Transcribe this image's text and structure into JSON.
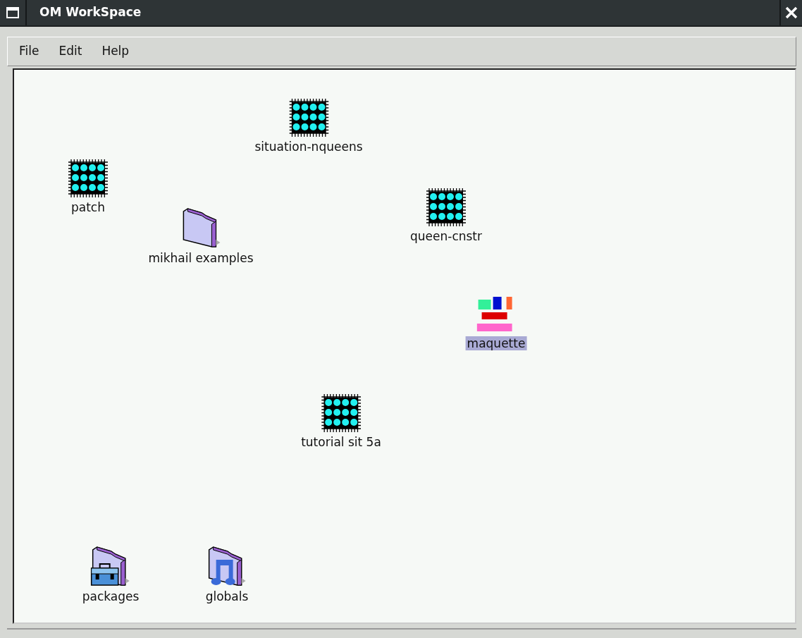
{
  "window": {
    "title": "OM WorkSpace"
  },
  "menu": [
    "File",
    "Edit",
    "Help"
  ],
  "items": [
    {
      "label": "situation-nqueens",
      "kind": "patch",
      "selected": false
    },
    {
      "label": "patch",
      "kind": "patch",
      "selected": false
    },
    {
      "label": "mikhail examples",
      "kind": "folder",
      "selected": false
    },
    {
      "label": "queen-cnstr",
      "kind": "patch",
      "selected": false
    },
    {
      "label": "maquette",
      "kind": "maquette",
      "selected": true
    },
    {
      "label": "tutorial sit 5a",
      "kind": "patch",
      "selected": false
    },
    {
      "label": "packages",
      "kind": "packages",
      "selected": false
    },
    {
      "label": "globals",
      "kind": "globals",
      "selected": false
    }
  ]
}
